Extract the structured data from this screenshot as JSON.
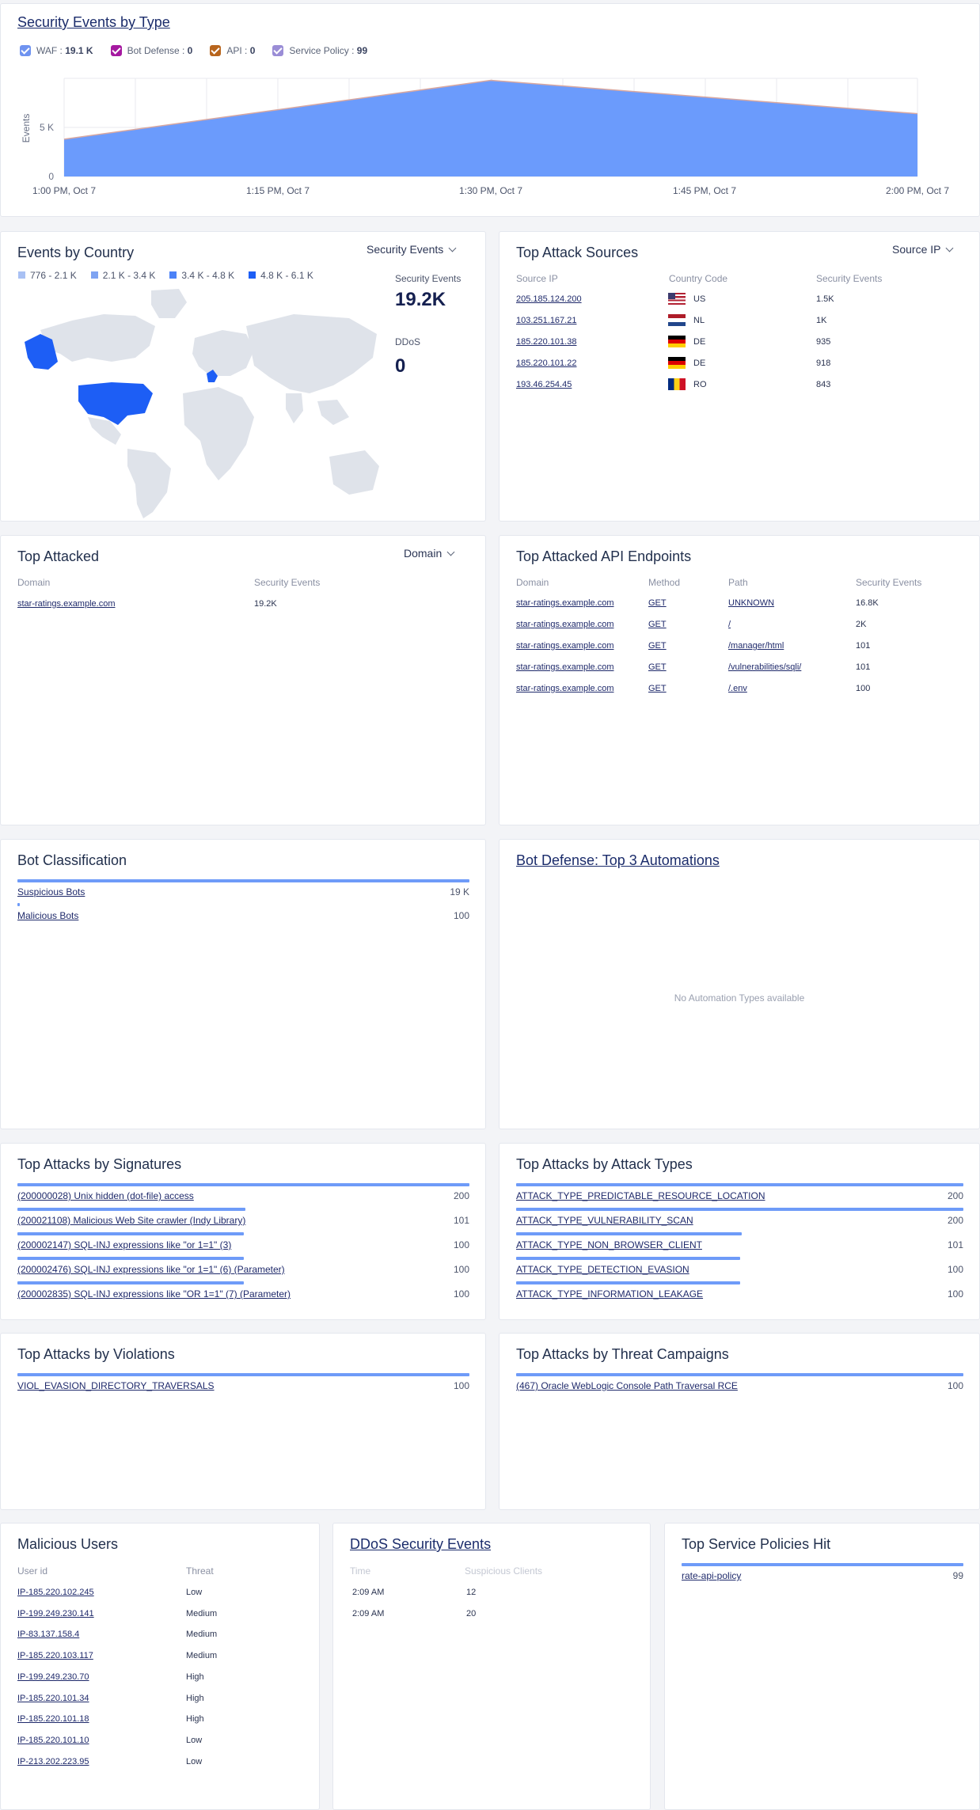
{
  "security_events": {
    "title": "Security Events by Type",
    "legend": [
      {
        "label": "WAF",
        "value": "19.1 K",
        "color": "#6f93f0"
      },
      {
        "label": "Bot Defense",
        "value": "0",
        "color": "#a519a0"
      },
      {
        "label": "API",
        "value": "0",
        "color": "#b8651d"
      },
      {
        "label": "Service Policy",
        "value": "99",
        "color": "#9a8dd6"
      }
    ],
    "ylabel": "Events",
    "yticks": [
      "5 K",
      "0"
    ],
    "xticks": [
      "1:00 PM, Oct 7",
      "1:15 PM, Oct 7",
      "1:30 PM, Oct 7",
      "1:45 PM, Oct 7",
      "2:00 PM, Oct 7"
    ]
  },
  "chart_data": {
    "type": "area",
    "title": "Security Events by Type",
    "xlabel": "",
    "ylabel": "Events",
    "x": [
      "1:00 PM, Oct 7",
      "1:30 PM, Oct 7",
      "2:00 PM, Oct 7"
    ],
    "series": [
      {
        "name": "WAF",
        "values": [
          3800,
          9800,
          6400
        ],
        "color": "#6b9bfc"
      }
    ],
    "ylim": [
      0,
      10000
    ],
    "grid": true
  },
  "country": {
    "title": "Events by Country",
    "dropdown": "Security Events",
    "legend": [
      {
        "label": "776  - 2.1 K",
        "color": "#a9c1f4"
      },
      {
        "label": "2.1 K - 3.4 K",
        "color": "#7ea3f2"
      },
      {
        "label": "3.4 K - 4.8 K",
        "color": "#4c82f7"
      },
      {
        "label": "4.8 K - 6.1 K",
        "color": "#1d5ef5"
      }
    ],
    "stat1_label": "Security Events",
    "stat1_value": "19.2K",
    "stat2_label": "DDoS",
    "stat2_value": "0"
  },
  "sources": {
    "title": "Top Attack Sources",
    "dropdown": "Source IP",
    "headers": [
      "Source IP",
      "Country Code",
      "Security Events"
    ],
    "rows": [
      {
        "ip": "205.185.124.200",
        "cc": "US",
        "events": "1.5K",
        "flag": "us"
      },
      {
        "ip": "103.251.167.21",
        "cc": "NL",
        "events": "1K",
        "flag": "nl"
      },
      {
        "ip": "185.220.101.38",
        "cc": "DE",
        "events": "935",
        "flag": "de"
      },
      {
        "ip": "185.220.101.22",
        "cc": "DE",
        "events": "918",
        "flag": "de"
      },
      {
        "ip": "193.46.254.45",
        "cc": "RO",
        "events": "843",
        "flag": "ro"
      }
    ]
  },
  "attacked": {
    "title": "Top Attacked",
    "dropdown": "Domain",
    "headers": [
      "Domain",
      "Security Events"
    ],
    "rows": [
      {
        "domain": "star-ratings.example.com",
        "events": "19.2K"
      }
    ]
  },
  "api": {
    "title": "Top Attacked API Endpoints",
    "headers": [
      "Domain",
      "Method",
      "Path",
      "Security Events"
    ],
    "rows": [
      {
        "domain": "star-ratings.example.com",
        "method": "GET",
        "path": "UNKNOWN",
        "events": "16.8K"
      },
      {
        "domain": "star-ratings.example.com",
        "method": "GET",
        "path": "/",
        "events": "2K"
      },
      {
        "domain": "star-ratings.example.com",
        "method": "GET",
        "path": "/manager/html",
        "events": "101"
      },
      {
        "domain": "star-ratings.example.com",
        "method": "GET",
        "path": "/vulnerabilities/sqli/",
        "events": "101"
      },
      {
        "domain": "star-ratings.example.com",
        "method": "GET",
        "path": "/.env",
        "events": "100"
      }
    ]
  },
  "bot": {
    "title": "Bot Classification",
    "rows": [
      {
        "label": "Suspicious Bots",
        "value": "19 K",
        "pct": 1.0
      },
      {
        "label": "Malicious Bots",
        "value": "100",
        "pct": 0.005
      }
    ]
  },
  "automations": {
    "title": "Bot Defense: Top 3 Automations",
    "empty": "No Automation Types available"
  },
  "signatures": {
    "title": "Top Attacks by Signatures",
    "rows": [
      {
        "label": "(200000028) Unix hidden (dot-file) access",
        "value": "200",
        "pct": 1.0
      },
      {
        "label": "(200021108) Malicious Web Site crawler (Indy Library)",
        "value": "101",
        "pct": 0.505
      },
      {
        "label": "(200002147) SQL-INJ expressions like \"or 1=1\" (3)",
        "value": "100",
        "pct": 0.5
      },
      {
        "label": "(200002476) SQL-INJ expressions like \"or 1=1\" (6) (Parameter)",
        "value": "100",
        "pct": 0.5
      },
      {
        "label": "(200002835) SQL-INJ expressions like \"OR 1=1\" (7) (Parameter)",
        "value": "100",
        "pct": 0.5
      }
    ]
  },
  "attack_types": {
    "title": "Top Attacks by Attack Types",
    "rows": [
      {
        "label": "ATTACK_TYPE_PREDICTABLE_RESOURCE_LOCATION",
        "value": "200",
        "pct": 1.0
      },
      {
        "label": "ATTACK_TYPE_VULNERABILITY_SCAN",
        "value": "200",
        "pct": 1.0
      },
      {
        "label": "ATTACK_TYPE_NON_BROWSER_CLIENT",
        "value": "101",
        "pct": 0.505
      },
      {
        "label": "ATTACK_TYPE_DETECTION_EVASION",
        "value": "100",
        "pct": 0.5
      },
      {
        "label": "ATTACK_TYPE_INFORMATION_LEAKAGE",
        "value": "100",
        "pct": 0.5
      }
    ]
  },
  "violations": {
    "title": "Top Attacks by Violations",
    "rows": [
      {
        "label": "VIOL_EVASION_DIRECTORY_TRAVERSALS",
        "value": "100",
        "pct": 1.0
      }
    ]
  },
  "campaigns": {
    "title": "Top Attacks by Threat Campaigns",
    "rows": [
      {
        "label": "(467) Oracle WebLogic Console Path Traversal RCE",
        "value": "100",
        "pct": 1.0
      }
    ]
  },
  "malicious": {
    "title": "Malicious Users",
    "headers": [
      "User id",
      "Threat"
    ],
    "rows": [
      {
        "user": "IP-185.220.102.245",
        "threat": "Low"
      },
      {
        "user": "IP-199.249.230.141",
        "threat": "Medium"
      },
      {
        "user": "IP-83.137.158.4",
        "threat": "Medium"
      },
      {
        "user": "IP-185.220.103.117",
        "threat": "Medium"
      },
      {
        "user": "IP-199.249.230.70",
        "threat": "High"
      },
      {
        "user": "IP-185.220.101.34",
        "threat": "High"
      },
      {
        "user": "IP-185.220.101.18",
        "threat": "High"
      },
      {
        "user": "IP-185.220.101.10",
        "threat": "Low"
      },
      {
        "user": "IP-213.202.223.95",
        "threat": "Low"
      }
    ]
  },
  "ddos": {
    "title": "DDoS Security Events",
    "headers": [
      "Time",
      "Suspicious Clients"
    ],
    "rows": [
      {
        "time": "2:09 AM",
        "clients": "12"
      },
      {
        "time": "2:09 AM",
        "clients": "20"
      }
    ]
  },
  "policies": {
    "title": "Top Service Policies Hit",
    "rows": [
      {
        "label": "rate-api-policy",
        "value": "99",
        "pct": 1.0
      }
    ]
  }
}
